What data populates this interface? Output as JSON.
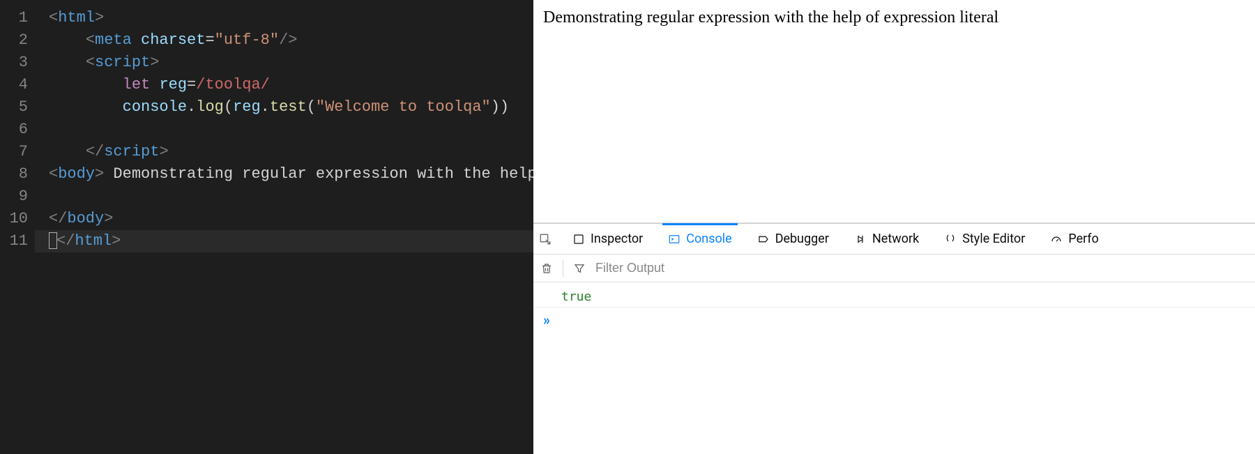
{
  "editor": {
    "line_numbers": [
      "1",
      "2",
      "3",
      "4",
      "5",
      "6",
      "7",
      "8",
      "9",
      "10",
      "11"
    ],
    "cursor_line_index": 10,
    "lines": [
      {
        "indent": 0,
        "tokens": [
          {
            "t": "tag",
            "v": "<"
          },
          {
            "t": "elem",
            "v": "html"
          },
          {
            "t": "tag",
            "v": ">"
          }
        ]
      },
      {
        "indent": 1,
        "tokens": [
          {
            "t": "tag",
            "v": "<"
          },
          {
            "t": "elem",
            "v": "meta"
          },
          {
            "t": "plain",
            "v": " "
          },
          {
            "t": "attr",
            "v": "charset"
          },
          {
            "t": "op",
            "v": "="
          },
          {
            "t": "str",
            "v": "\"utf-8\""
          },
          {
            "t": "tag",
            "v": "/>"
          }
        ]
      },
      {
        "indent": 1,
        "tokens": [
          {
            "t": "tag",
            "v": "<"
          },
          {
            "t": "elem",
            "v": "script"
          },
          {
            "t": "tag",
            "v": ">"
          }
        ]
      },
      {
        "indent": 2,
        "tokens": [
          {
            "t": "kw2",
            "v": "let"
          },
          {
            "t": "plain",
            "v": " "
          },
          {
            "t": "var",
            "v": "reg"
          },
          {
            "t": "op",
            "v": "="
          },
          {
            "t": "regex",
            "v": "/toolqa/"
          }
        ]
      },
      {
        "indent": 2,
        "tokens": [
          {
            "t": "obj",
            "v": "console"
          },
          {
            "t": "op",
            "v": "."
          },
          {
            "t": "fn",
            "v": "log"
          },
          {
            "t": "op",
            "v": "("
          },
          {
            "t": "var",
            "v": "reg"
          },
          {
            "t": "op",
            "v": "."
          },
          {
            "t": "fn",
            "v": "test"
          },
          {
            "t": "op",
            "v": "("
          },
          {
            "t": "str",
            "v": "\"Welcome to toolqa\""
          },
          {
            "t": "op",
            "v": "))"
          }
        ]
      },
      {
        "indent": 2,
        "tokens": []
      },
      {
        "indent": 1,
        "tokens": [
          {
            "t": "tag",
            "v": "</"
          },
          {
            "t": "elem",
            "v": "script"
          },
          {
            "t": "tag",
            "v": ">"
          }
        ]
      },
      {
        "indent": 0,
        "tokens": [
          {
            "t": "tag",
            "v": "<"
          },
          {
            "t": "elem",
            "v": "body"
          },
          {
            "t": "tag",
            "v": ">"
          },
          {
            "t": "text",
            "v": " Demonstrating regular expression with the help"
          }
        ]
      },
      {
        "indent": 0,
        "tokens": []
      },
      {
        "indent": 0,
        "tokens": [
          {
            "t": "tag",
            "v": "</"
          },
          {
            "t": "elem",
            "v": "body"
          },
          {
            "t": "tag",
            "v": ">"
          }
        ]
      },
      {
        "indent": 0,
        "cursor": true,
        "tokens": [
          {
            "t": "tag",
            "v": "</"
          },
          {
            "t": "elem",
            "v": "html"
          },
          {
            "t": "tag",
            "v": ">"
          }
        ]
      }
    ]
  },
  "page": {
    "body_text": "Demonstrating regular expression with the help of expression literal"
  },
  "devtools": {
    "tabs": [
      {
        "id": "inspector",
        "label": "Inspector",
        "icon": "inspector"
      },
      {
        "id": "console",
        "label": "Console",
        "icon": "console",
        "active": true
      },
      {
        "id": "debugger",
        "label": "Debugger",
        "icon": "debugger"
      },
      {
        "id": "network",
        "label": "Network",
        "icon": "network"
      },
      {
        "id": "styleeditor",
        "label": "Style Editor",
        "icon": "style"
      },
      {
        "id": "performance",
        "label": "Perfo",
        "icon": "perf"
      }
    ],
    "filter_placeholder": "Filter Output",
    "log_value": "true",
    "prompt": "»"
  }
}
